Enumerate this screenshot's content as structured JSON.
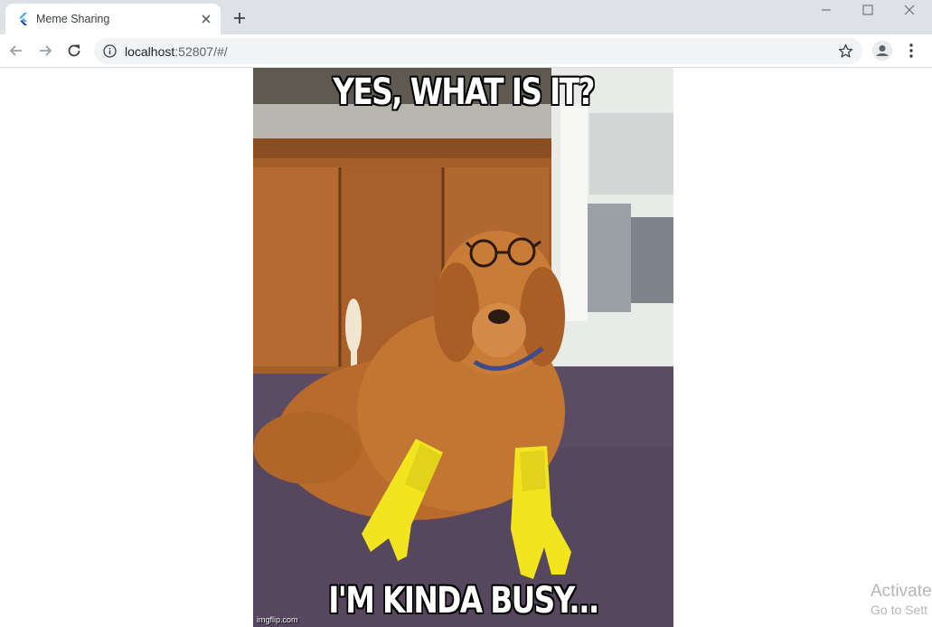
{
  "browser": {
    "tab": {
      "title": "Meme Sharing",
      "favicon": "flutter-logo-icon"
    },
    "url": {
      "host": "localhost",
      "rest": ":52807/#/"
    },
    "colors": {
      "tabstrip": "#dee1e6",
      "omnibox": "#f1f3f4"
    }
  },
  "meme": {
    "top_text": "YES, WHAT IS IT?",
    "bottom_text": "I'M KINDA BUSY...",
    "watermark": "imgflip.com"
  },
  "overlay": {
    "activate_title": "Activate",
    "activate_sub": "Go to Sett"
  }
}
